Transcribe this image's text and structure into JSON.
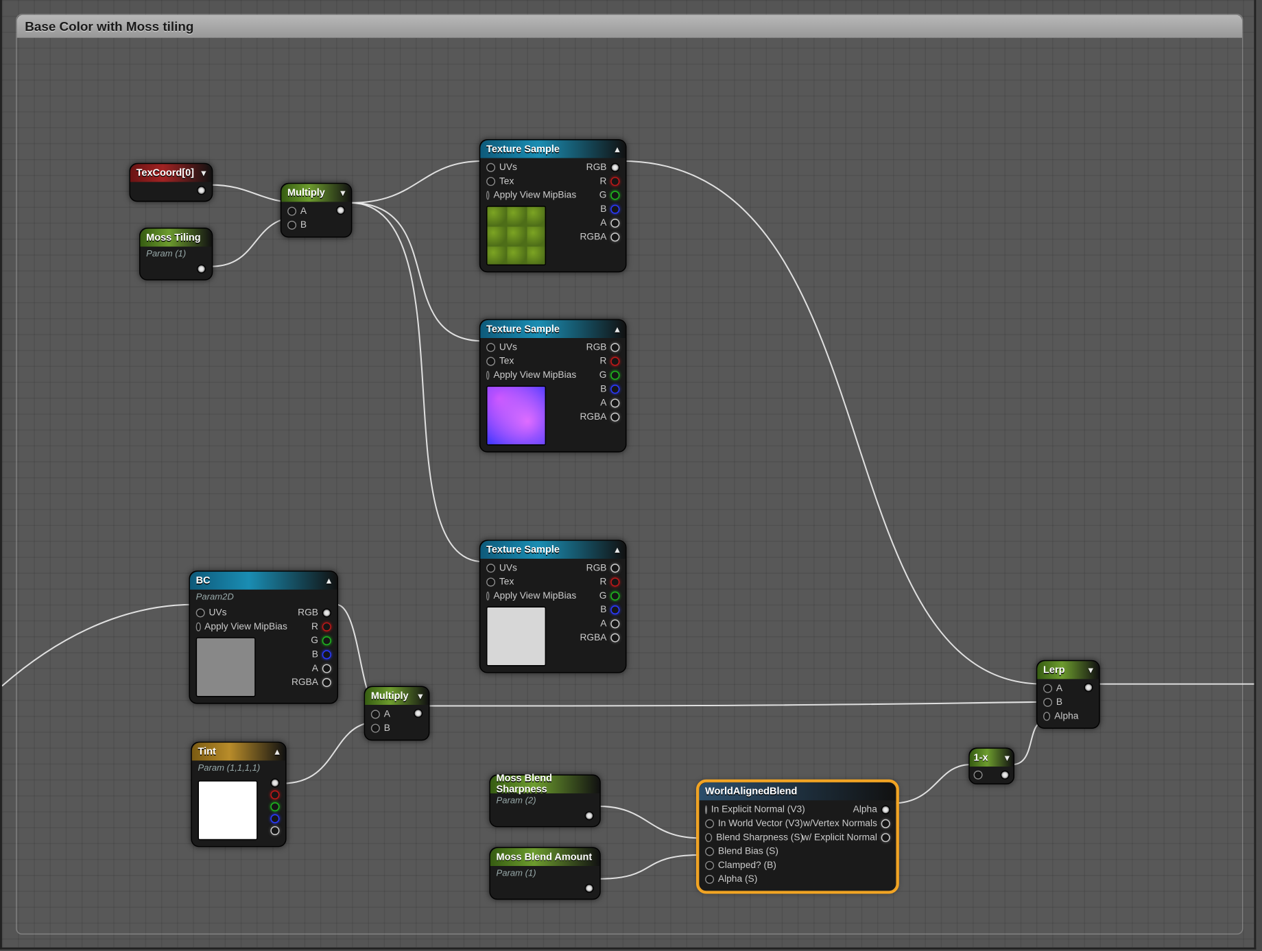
{
  "comment_title": "Base Color with Moss tiling",
  "texcoord": {
    "title": "TexCoord[0]"
  },
  "moss_tiling": {
    "title": "Moss Tiling",
    "sub": "Param (1)"
  },
  "multiply1": {
    "title": "Multiply",
    "inA": "A",
    "inB": "B"
  },
  "multiply2": {
    "title": "Multiply",
    "inA": "A",
    "inB": "B"
  },
  "texsample": {
    "title": "Texture Sample",
    "uvs": "UVs",
    "tex": "Tex",
    "mip": "Apply View MipBias",
    "rgb": "RGB",
    "r": "R",
    "g": "G",
    "b": "B",
    "a": "A",
    "rgba": "RGBA"
  },
  "bc": {
    "title": "BC",
    "sub": "Param2D",
    "uvs": "UVs",
    "mip": "Apply View MipBias",
    "rgb": "RGB",
    "r": "R",
    "g": "G",
    "b": "B",
    "a": "A",
    "rgba": "RGBA"
  },
  "tint": {
    "title": "Tint",
    "sub": "Param (1,1,1,1)"
  },
  "sharp": {
    "title": "Moss Blend Sharpness",
    "sub": "Param (2)"
  },
  "amount": {
    "title": "Moss Blend Amount",
    "sub": "Param (1)"
  },
  "wab": {
    "title": "WorldAlignedBlend",
    "in_normal": "In Explicit Normal (V3)",
    "in_world": "In World Vector (V3)",
    "sharp": "Blend Sharpness (S)",
    "bias": "Blend Bias (S)",
    "clamp": "Clamped? (B)",
    "alphaS": "Alpha (S)",
    "out_alpha": "Alpha",
    "out_vn": "w/Vertex Normals",
    "out_en": "w/ Explicit Normal"
  },
  "onemx": {
    "title": "1-x"
  },
  "lerp": {
    "title": "Lerp",
    "a": "A",
    "b": "B",
    "alpha": "Alpha"
  }
}
